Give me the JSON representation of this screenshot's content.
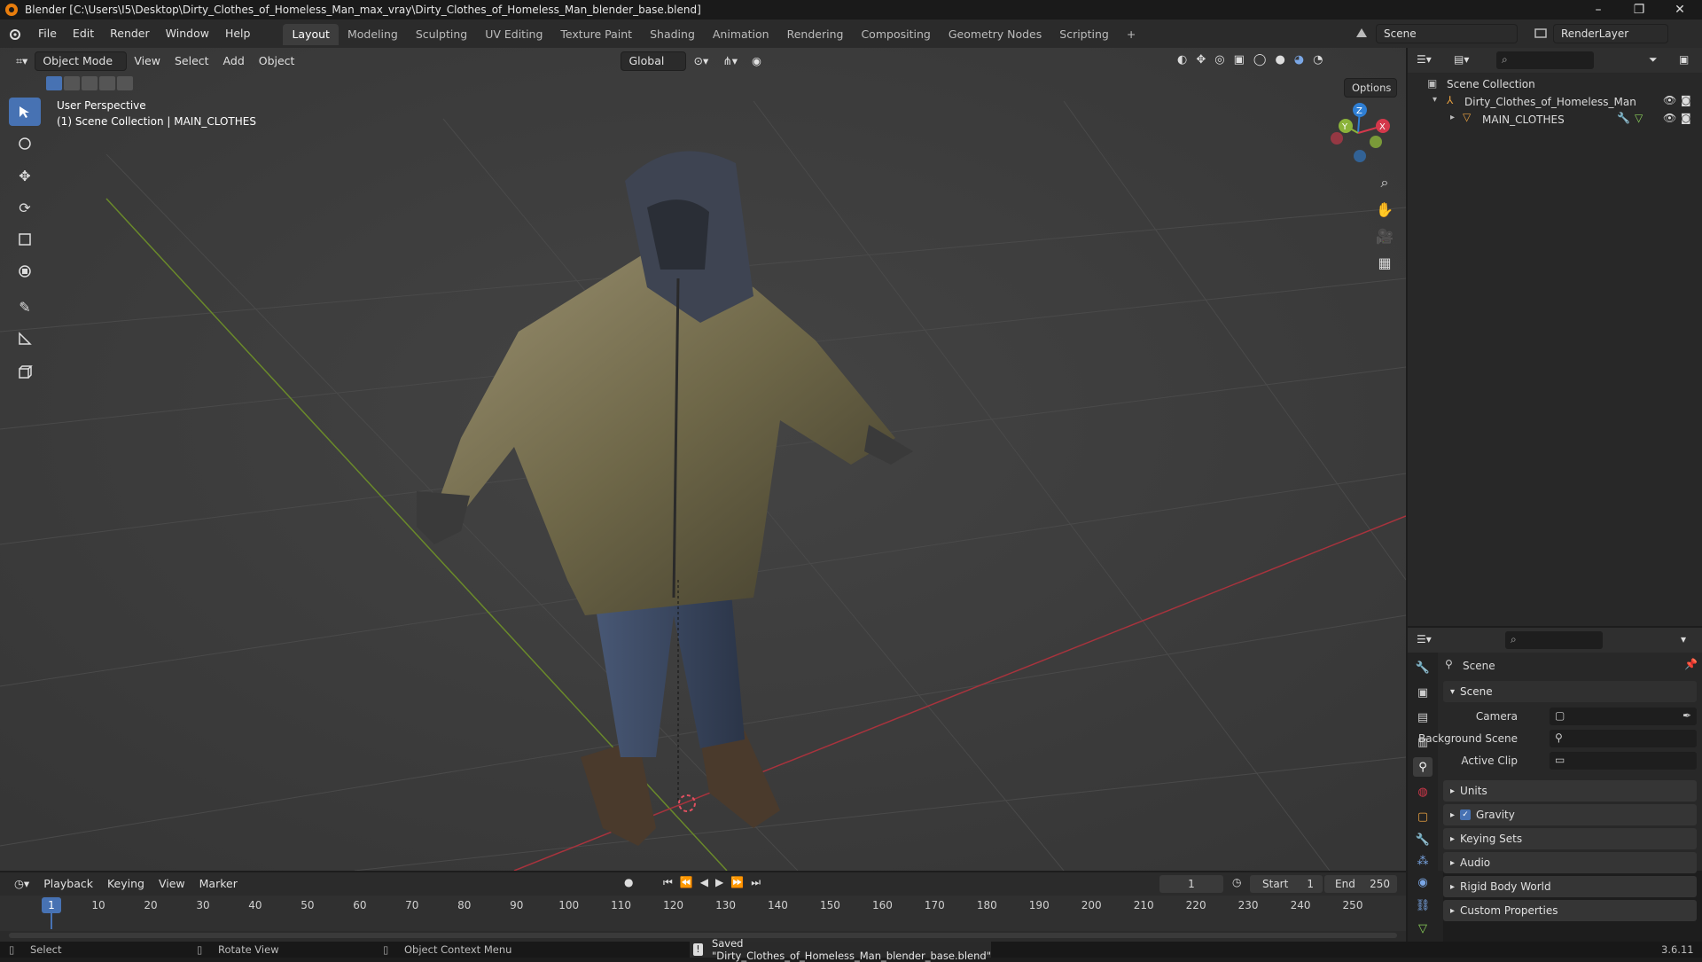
{
  "window": {
    "title": "Blender [C:\\Users\\I5\\Desktop\\Dirty_Clothes_of_Homeless_Man_max_vray\\Dirty_Clothes_of_Homeless_Man_blender_base.blend]",
    "controls": [
      "–",
      "❐",
      "✕"
    ]
  },
  "menu": [
    "File",
    "Edit",
    "Render",
    "Window",
    "Help"
  ],
  "workspaces": [
    "Layout",
    "Modeling",
    "Sculpting",
    "UV Editing",
    "Texture Paint",
    "Shading",
    "Animation",
    "Rendering",
    "Compositing",
    "Geometry Nodes",
    "Scripting",
    "+"
  ],
  "topright": {
    "scene": "Scene",
    "render_layer": "RenderLayer"
  },
  "viewport": {
    "mode": "Object Mode",
    "menus": [
      "View",
      "Select",
      "Add",
      "Object"
    ],
    "orientation": "Global",
    "options_label": "Options",
    "overlay_line1": "User Perspective",
    "overlay_line2": "(1) Scene Collection | MAIN_CLOTHES",
    "axes": {
      "x": "X",
      "y": "Y",
      "z": "Z"
    }
  },
  "outliner": {
    "root": "Scene Collection",
    "items": [
      "Dirty_Clothes_of_Homeless_Man",
      "MAIN_CLOTHES"
    ]
  },
  "properties": {
    "header": "Scene",
    "section": "Scene",
    "fields": [
      {
        "label": "Camera"
      },
      {
        "label": "Background Scene"
      },
      {
        "label": "Active Clip"
      }
    ],
    "panels": [
      "Units",
      "Gravity",
      "Keying Sets",
      "Audio",
      "Rigid Body World",
      "Custom Properties"
    ]
  },
  "timeline": {
    "menus": [
      "Playback",
      "Keying",
      "View",
      "Marker"
    ],
    "current_frame": "1",
    "start_label": "Start",
    "start": "1",
    "end_label": "End",
    "end": "250",
    "ticks": [
      "1",
      "10",
      "20",
      "30",
      "40",
      "50",
      "60",
      "70",
      "80",
      "90",
      "100",
      "110",
      "120",
      "130",
      "140",
      "150",
      "160",
      "170",
      "180",
      "190",
      "200",
      "210",
      "220",
      "230",
      "240",
      "250"
    ]
  },
  "status": {
    "select": "Select",
    "rotate": "Rotate View",
    "context": "Object Context Menu",
    "message": "Saved \"Dirty_Clothes_of_Homeless_Man_blender_base.blend\"",
    "version": "3.6.11"
  },
  "colors": {
    "accent": "#4772b3",
    "axis_x": "#d4384b",
    "axis_y": "#8bb33a",
    "axis_z": "#2f7fd4",
    "orange": "#e87d0d"
  }
}
